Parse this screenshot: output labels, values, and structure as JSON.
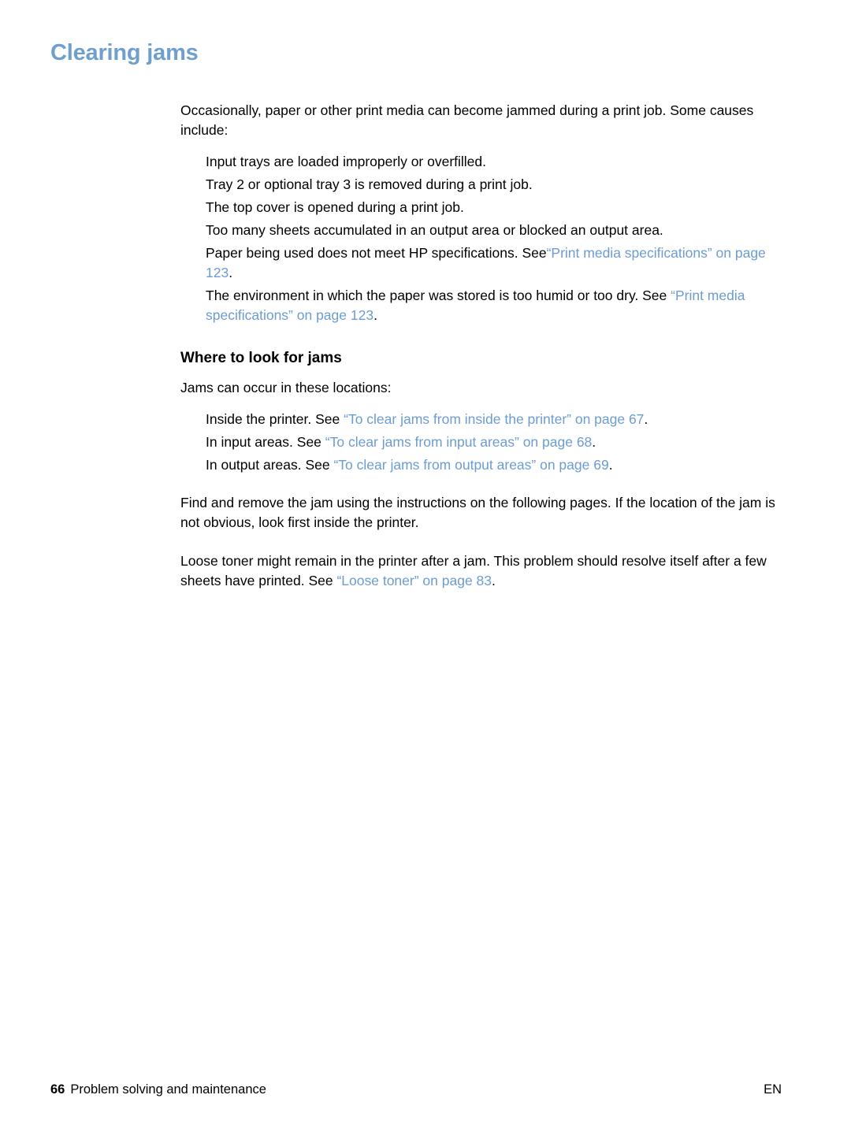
{
  "document": {
    "chapter_title": "Clearing jams"
  },
  "intro": {
    "paragraph": "Occasionally, paper or other print media can become jammed during a print job. Some causes include:"
  },
  "causes": [
    {
      "text": "Input trays are loaded improperly or overfilled."
    },
    {
      "text": "Tray 2 or optional tray 3 is removed during a print job."
    },
    {
      "text": "The top cover is opened during a print job."
    },
    {
      "text": "Too many sheets accumulated in an output area or blocked an output area."
    },
    {
      "text_before": "Paper being used does not meet HP specifications. See",
      "link": "“Print media specifications” on page 123",
      "text_after": "."
    },
    {
      "text_before": "The environment in which the paper was stored is too humid or too dry. See ",
      "link": "“Print media specifications” on page 123",
      "text_after": "."
    }
  ],
  "where_to_look": {
    "heading": "Where to look for jams",
    "intro": "Jams can occur in these locations:",
    "locations": [
      {
        "text_before": "Inside the printer. See ",
        "link": "“To clear jams from inside the printer” on page 67",
        "text_after": "."
      },
      {
        "text_before": "In input areas. See ",
        "link": "“To clear jams from input areas” on page 68",
        "text_after": "."
      },
      {
        "text_before": "In output areas. See ",
        "link": "“To clear jams from output areas” on page 69",
        "text_after": "."
      }
    ]
  },
  "closing": {
    "paragraph_1": "Find and remove the jam using the instructions on the following pages. If the location of the jam is not obvious, look first inside the printer.",
    "paragraph_2_before": "Loose toner might remain in the printer after a jam. This problem should resolve itself after a few sheets have printed. See ",
    "paragraph_2_link": "“Loose toner” on page 83",
    "paragraph_2_after": "."
  },
  "footer": {
    "page_number": "66",
    "section_title": "Problem solving and maintenance",
    "language": "EN"
  },
  "colors": {
    "heading_blue": "#6e9fcd",
    "link_blue": "#6c9cd2",
    "body_black": "#000000",
    "page_background": "#ffffff"
  }
}
